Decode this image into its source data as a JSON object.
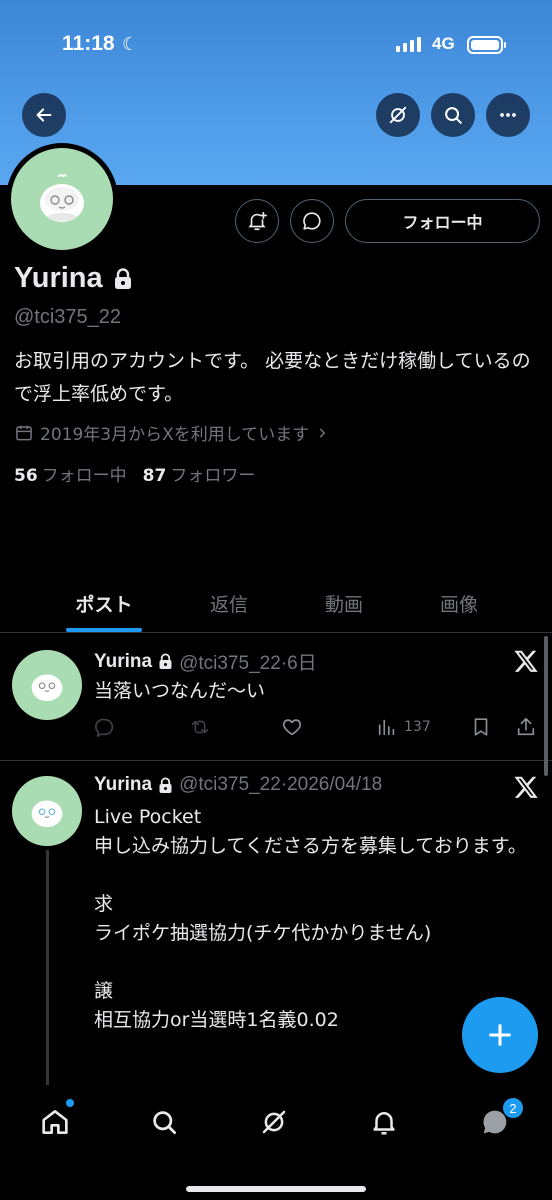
{
  "status_bar": {
    "time": "11:18",
    "network": "4G"
  },
  "profile": {
    "name": "Yurina",
    "handle": "@tci375_22",
    "bio": "お取引用のアカウントです。 必要なときだけ稼働しているので浮上率低めです。",
    "joined": "2019年3月からXを利用しています",
    "following_count": "56",
    "following_label": "フォロー中",
    "followers_count": "87",
    "followers_label": "フォロワー",
    "follow_button_label": "フォロー中"
  },
  "tabs": [
    {
      "label": "ポスト",
      "active": true
    },
    {
      "label": "返信",
      "active": false
    },
    {
      "label": "動画",
      "active": false
    },
    {
      "label": "画像",
      "active": false
    }
  ],
  "posts": [
    {
      "name": "Yurina",
      "meta": "@tci375_22·6日",
      "text": "当落いつなんだ〜い",
      "views": "137"
    },
    {
      "name": "Yurina",
      "meta": "@tci375_22·2026/04/18",
      "text": "Live Pocket\n申し込み協力してくださる方を募集しております。\n\n求\nライポケ抽選協力(チケ代かかりません)\n\n譲\n相互協力or当選時1名義0.02"
    }
  ],
  "nav": {
    "messages_badge": "2"
  },
  "colors": {
    "accent": "#1d9bf0",
    "banner": "#4e9be8",
    "background": "#000000",
    "muted": "#71767b"
  }
}
